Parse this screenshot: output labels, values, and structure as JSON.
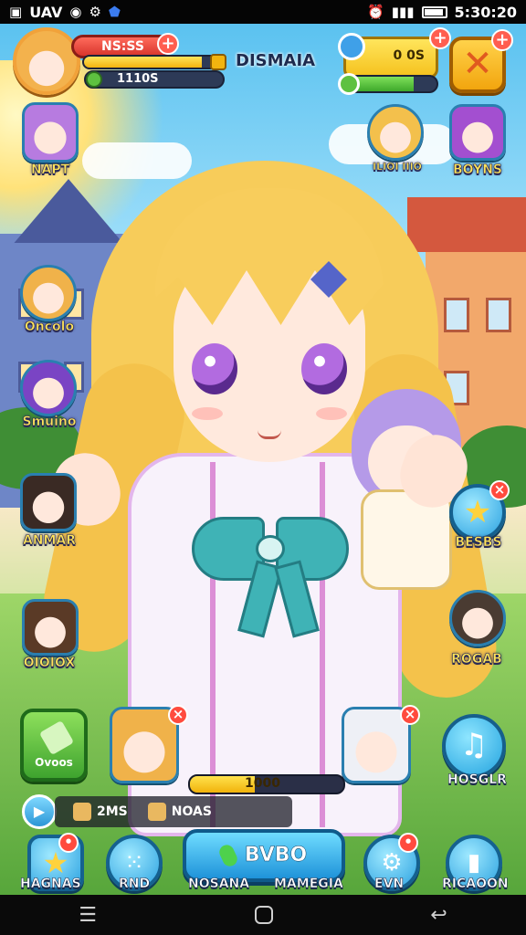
{
  "status_bar": {
    "left_text": "UAV",
    "time": "5:30:20"
  },
  "player": {
    "hp_label": "NS:SS",
    "exp_fill": 0.85,
    "gold_label": "1110S",
    "name": "DISMAIA"
  },
  "resources": {
    "amount": "0 0S",
    "bar_fill": 0.75
  },
  "left_friends": [
    {
      "label": "NAPT"
    },
    {
      "label": "Oncolo"
    },
    {
      "label": "Smuino"
    },
    {
      "label": "ANMAR"
    },
    {
      "label": "OIOIOX"
    }
  ],
  "right_friends": [
    {
      "label": "ILIOI IIIO"
    },
    {
      "label": "BOYNS"
    },
    {
      "label": "BESBS"
    },
    {
      "label": "ROGAB"
    }
  ],
  "quest": {
    "label": "Ovoos"
  },
  "stamina": {
    "value": "1000",
    "fill": 0.42
  },
  "music": {
    "label": "HOSGLR"
  },
  "ticker": {
    "items": [
      {
        "text": "2MS"
      },
      {
        "text": "NOAS"
      }
    ]
  },
  "bottom_nav": {
    "left1": "HAGNAS",
    "left2": "RND",
    "main_action": "BVBO",
    "main_sub_left": "NOSANA",
    "main_sub_right": "MAMEGIA",
    "right1": "EVN",
    "right2": "RICAOON"
  },
  "colors": {
    "accent_blue": "#2ba1e0",
    "accent_gold": "#f5c21e",
    "accent_red": "#ff4b3e",
    "accent_green": "#3ea32e"
  }
}
